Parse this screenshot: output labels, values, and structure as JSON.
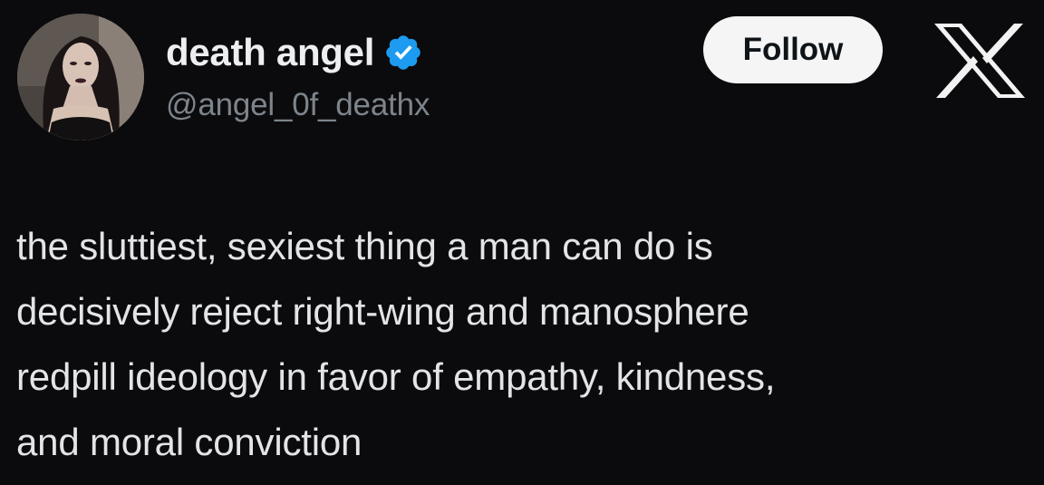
{
  "tweet": {
    "author": {
      "display_name": "death angel",
      "handle": "@angel_0f_deathx",
      "verified": true,
      "avatar_icon": "profile-photo"
    },
    "follow_label": "Follow",
    "platform_icon": "x-logo-icon",
    "body": "the sluttiest, sexiest thing a man can do is\ndecisively reject right-wing and manosphere\nredpill ideology in favor of empathy, kindness,\nand moral conviction"
  },
  "colors": {
    "background": "#0b0b0d",
    "text": "#e7e9ea",
    "handle": "#7d848b",
    "verified_badge": "#1d9bf0",
    "follow_button_bg": "#f5f5f5",
    "follow_button_text": "#0f1419"
  }
}
